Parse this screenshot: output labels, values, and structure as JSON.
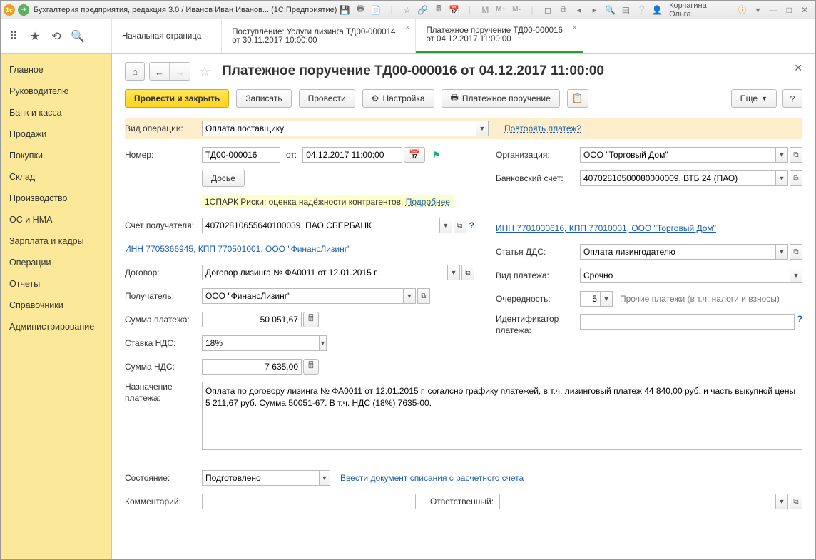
{
  "titlebar": {
    "app_title": "Бухгалтерия предприятия, редакция 3.0 / Иванов Иван Иванов...  (1С:Предприятие)",
    "user": "Корчагина Ольга"
  },
  "tabs": {
    "start": "Начальная страница",
    "tab1_l1": "Поступление: Услуги лизинга ТД00-000014",
    "tab1_l2": "от 30.11.2017 10:00:00",
    "tab2_l1": "Платежное поручение ТД00-000016",
    "tab2_l2": "от 04.12.2017 11:00:00"
  },
  "sidebar": [
    "Главное",
    "Руководителю",
    "Банк и касса",
    "Продажи",
    "Покупки",
    "Склад",
    "Производство",
    "ОС и НМА",
    "Зарплата и кадры",
    "Операции",
    "Отчеты",
    "Справочники",
    "Администрирование"
  ],
  "page": {
    "title": "Платежное поручение ТД00-000016 от 04.12.2017 11:00:00"
  },
  "toolbar": {
    "post_close": "Провести и закрыть",
    "save": "Записать",
    "post": "Провести",
    "settings": "Настройка",
    "print": "Платежное поручение",
    "more": "Еще",
    "help": "?"
  },
  "labels": {
    "op_type": "Вид операции:",
    "repeat": "Повторять платеж?",
    "number": "Номер:",
    "from": "от:",
    "org": "Организация:",
    "dossier": "Досье",
    "bank_acc": "Банковский счет:",
    "spark": "1СПАРК Риски: оценка надёжности контрагентов.",
    "spark_more": "Подробнее",
    "recipient_acc": "Счет получателя:",
    "recipient_link": "ИНН 7701030616, КПП 77010001, ООО \"Торговый Дом\"",
    "payer_link": "ИНН 7705366945, КПП 770501001, ООО \"ФинансЛизинг\"",
    "dds": "Статья ДДС:",
    "contract": "Договор:",
    "pay_type": "Вид платежа:",
    "recipient": "Получатель:",
    "priority": "Очередность:",
    "priority_note": "Прочие платежи (в т.ч. налоги и взносы)",
    "amount": "Сумма платежа:",
    "pay_id": "Идентификатор платежа:",
    "vat_rate": "Ставка НДС:",
    "vat_sum": "Сумма НДС:",
    "purpose": "Назначение платежа:",
    "state": "Состояние:",
    "state_link": "Ввести документ списания с расчетного счета",
    "comment": "Комментарий:",
    "responsible": "Ответственный:"
  },
  "values": {
    "op_type": "Оплата поставщику",
    "number": "ТД00-000016",
    "date": "04.12.2017 11:00:00",
    "org": "ООО \"Торговый Дом\"",
    "bank_acc": "40702810500080000009, ВТБ 24 (ПАО)",
    "recipient_acc": "40702810655640100039, ПАО СБЕРБАНК",
    "dds": "Оплата лизингодателю",
    "contract": "Договор лизинга № ФА0011 от 12.01.2015 г.",
    "pay_type": "Срочно",
    "recipient": "ООО \"ФинансЛизинг\"",
    "priority": "5",
    "amount": "50 051,67",
    "vat_rate": "18%",
    "vat_sum": "7 635,00",
    "purpose": "Оплата по договору лизинга № ФА0011 от 12.01.2015 г. согалсно графику платежей, в т.ч. лизинговый платеж 44 840,00 руб. и часть выкупной цены 5 211,67 руб. Сумма 50051-67. В т.ч. НДС (18%) 7635-00.",
    "state": "Подготовлено",
    "pay_id": "",
    "comment": "",
    "responsible": ""
  }
}
